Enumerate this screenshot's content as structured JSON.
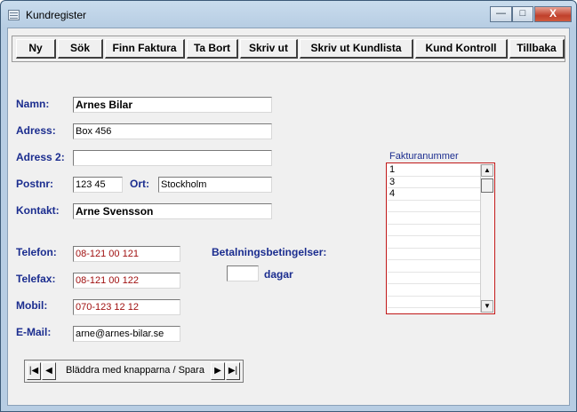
{
  "window": {
    "title": "Kundregister",
    "minimize": "—",
    "maximize": "□",
    "close": "X"
  },
  "toolbar": {
    "buttons": [
      "Ny",
      "Sök",
      "Finn Faktura",
      "Ta Bort",
      "Skriv ut",
      "Skriv ut Kundlista",
      "Kund Kontroll",
      "Tillbaka"
    ]
  },
  "form": {
    "name_label": "Namn:",
    "name_value": "Arnes Bilar",
    "address_label": "Adress:",
    "address_value": "Box 456",
    "address2_label": "Adress 2:",
    "address2_value": "",
    "postnr_label": "Postnr:",
    "postnr_value": "123 45",
    "ort_label": "Ort:",
    "ort_value": "Stockholm",
    "contact_label": "Kontakt:",
    "contact_value": "Arne Svensson",
    "phone_label": "Telefon:",
    "phone_value": "08-121 00 121",
    "fax_label": "Telefax:",
    "fax_value": "08-121 00 122",
    "mobile_label": "Mobil:",
    "mobile_value": "070-123 12 12",
    "email_label": "E-Mail:",
    "email_value": "arne@arnes-bilar.se",
    "payment_label": "Betalningsbetingelser:",
    "payment_days_value": "",
    "days_label": "dagar"
  },
  "invoices": {
    "label": "Fakturanummer",
    "items": [
      "1",
      "3",
      "4"
    ]
  },
  "navigator": {
    "first": "|◀",
    "prev": "◀",
    "caption": "Bläddra med knapparna / Spara",
    "next": "▶",
    "last": "▶|"
  },
  "colors": {
    "label_blue": "#1b2d8f",
    "phone_red": "#a01010",
    "list_border": "#c01818"
  }
}
